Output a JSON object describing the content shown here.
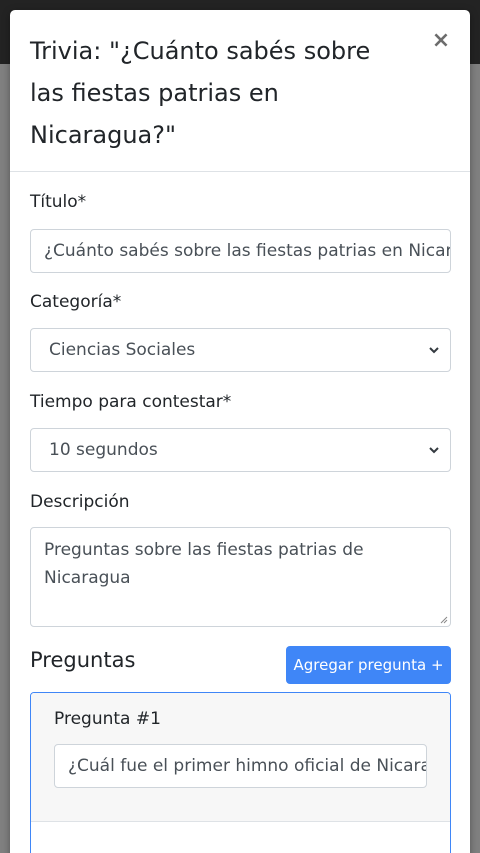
{
  "modal": {
    "title": "Trivia: \"¿Cuánto sabés sobre las fiestas patrias en Nicaragua?\"",
    "close_glyph": "×"
  },
  "form": {
    "titulo": {
      "label": "Título*",
      "value": "¿Cuánto sabés sobre las fiestas patrias en Nicaragua?"
    },
    "categoria": {
      "label": "Categoría*",
      "selected": "Ciencias Sociales"
    },
    "tiempo": {
      "label": "Tiempo para contestar*",
      "selected": "10 segundos"
    },
    "descripcion": {
      "label": "Descripción",
      "value": "Preguntas sobre las fiestas patrias de Nicaragua"
    }
  },
  "preguntas": {
    "heading": "Preguntas",
    "add_button_label": "Agregar pregunta +",
    "items": [
      {
        "title": "Pregunta #1",
        "value": "¿Cuál fue el primer himno oficial de Nicaragua?"
      }
    ]
  }
}
